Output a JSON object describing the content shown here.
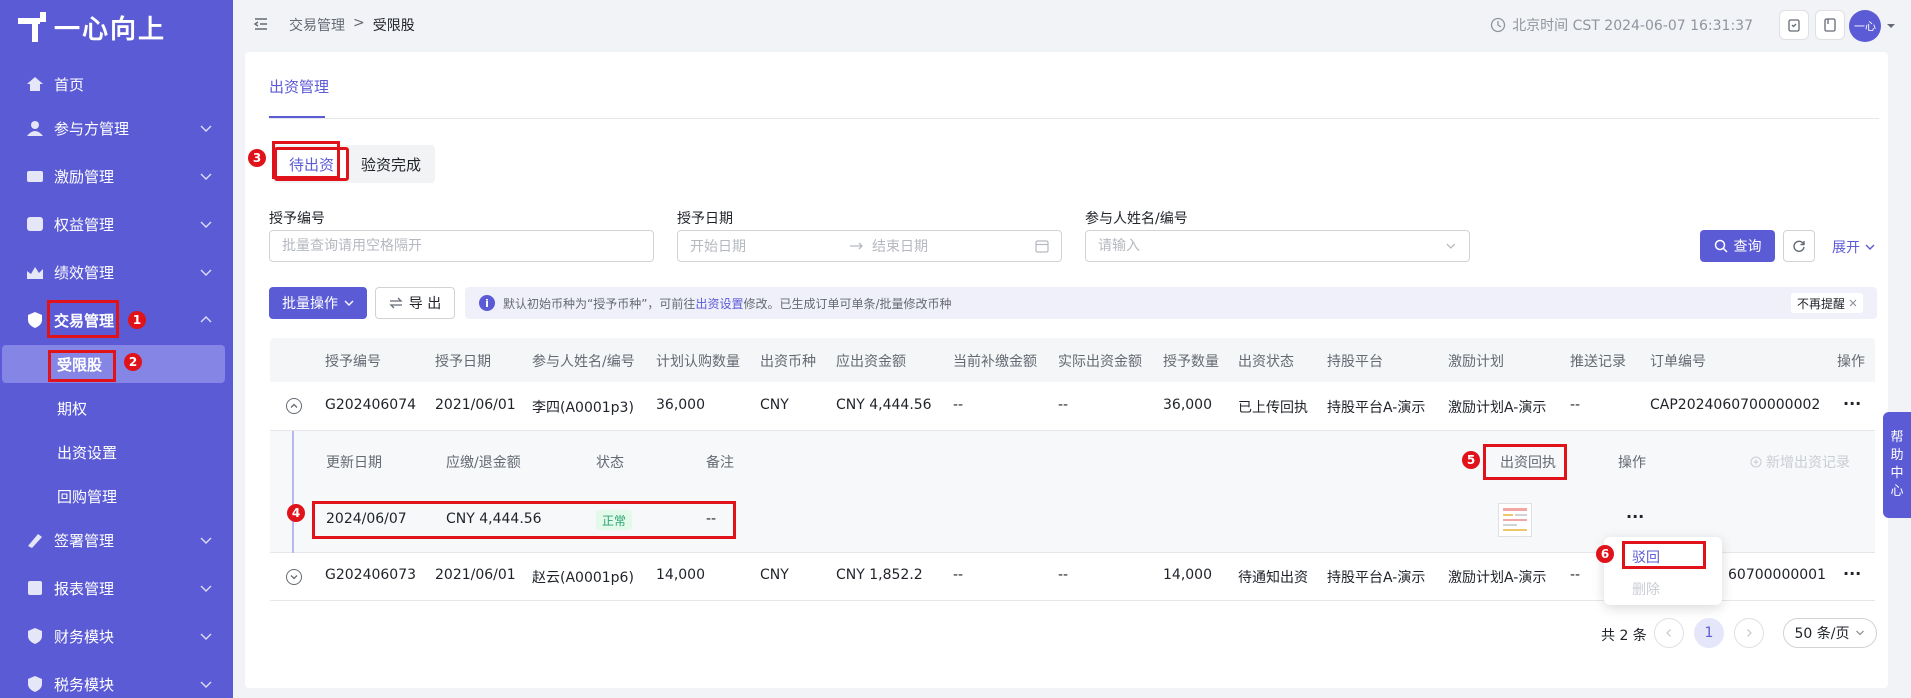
{
  "app": {
    "logo_text": "一心向上"
  },
  "sidebar": {
    "items": [
      {
        "label": "首页"
      },
      {
        "label": "参与方管理"
      },
      {
        "label": "激励管理"
      },
      {
        "label": "权益管理"
      },
      {
        "label": "绩效管理"
      },
      {
        "label": "交易管理"
      },
      {
        "label": "签署管理"
      },
      {
        "label": "报表管理"
      },
      {
        "label": "财务模块"
      },
      {
        "label": "税务模块"
      }
    ],
    "subitems": [
      {
        "label": "受限股"
      },
      {
        "label": "期权"
      },
      {
        "label": "出资设置"
      },
      {
        "label": "回购管理"
      }
    ]
  },
  "header": {
    "breadcrumb": [
      "交易管理",
      ">",
      "受限股"
    ],
    "clock": "北京时间 CST 2024-06-07 16:31:37",
    "avatar": "一心"
  },
  "tabs": {
    "main": "出资管理",
    "seg": [
      "待出资",
      "验资完成"
    ]
  },
  "filters": {
    "grant_no_label": "授予编号",
    "grant_no_placeholder": "批量查询请用空格隔开",
    "grant_date_label": "授予日期",
    "start_placeholder": "开始日期",
    "end_placeholder": "结束日期",
    "participant_label": "参与人姓名/编号",
    "participant_placeholder": "请输入",
    "query": "查询",
    "expand": "展开"
  },
  "toolbar": {
    "batch": "批量操作",
    "export": "导 出"
  },
  "notice": {
    "pre": "默认初始币种为“授予币种”，可前往 ",
    "link": "出资设置",
    "post": " 修改。已生成订单可单条/批量修改币种",
    "dismiss": "不再提醒"
  },
  "table": {
    "headers": [
      "授予编号",
      "授予日期",
      "参与人姓名/编号",
      "计划认购数量",
      "出资币种",
      "应出资金额",
      "当前补缴金额",
      "实际出资金额",
      "授予数量",
      "出资状态",
      "持股平台",
      "激励计划",
      "推送记录",
      "订单编号",
      "操作"
    ],
    "rows": [
      [
        "G202406074",
        "2021/06/01",
        "李四(A0001p3)",
        "36,000",
        "CNY",
        "CNY 4,444.56",
        "--",
        "--",
        "36,000",
        "已上传回执",
        "持股平台A-演示",
        "激励计划A-演示",
        "--",
        "CAP2024060700000002",
        "···"
      ],
      [
        "G202406073",
        "2021/06/01",
        "赵云(A0001p6)",
        "14,000",
        "CNY",
        "CNY 1,852.2",
        "--",
        "--",
        "14,000",
        "待通知出资",
        "持股平台A-演示",
        "激励计划A-演示",
        "--",
        "60700000001",
        "···"
      ]
    ],
    "sub_headers": [
      "更新日期",
      "应缴/退金额",
      "状态",
      "备注",
      "出资回执",
      "操作"
    ],
    "add_record": "新增出资记录",
    "sub_row": {
      "date": "2024/06/07",
      "amount": "CNY 4,444.56",
      "status": "正常",
      "remark": "--",
      "more": "···"
    }
  },
  "menu": {
    "reject": "驳回",
    "delete": "删除"
  },
  "pager": {
    "total": "共 2 条",
    "page": "1",
    "size": "50 条/页"
  },
  "help": [
    "帮",
    "助",
    "中",
    "心"
  ],
  "markers": [
    "1",
    "2",
    "3",
    "4",
    "5",
    "6"
  ],
  "colors": {
    "brand": "#5b5bd6",
    "highlight": "#e0121a"
  }
}
